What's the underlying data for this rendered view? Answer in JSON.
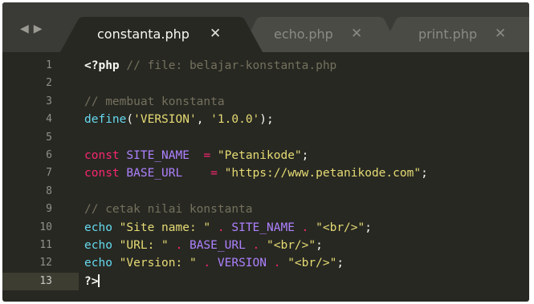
{
  "nav": {
    "back_icon": "◀",
    "forward_icon": "▶"
  },
  "tabs": [
    {
      "label": "constanta.php",
      "close": "✕",
      "active": true
    },
    {
      "label": "echo.php",
      "close": "✕",
      "active": false
    },
    {
      "label": "print.php",
      "close": "✕",
      "active": false
    }
  ],
  "colors": {
    "background": "#272822",
    "comment": "#75715e",
    "string": "#e6db74",
    "keyword": "#f92672",
    "function": "#66d9ef",
    "constant": "#ae81ff"
  },
  "editor": {
    "current_line": 13,
    "line_numbers": [
      "1",
      "2",
      "3",
      "4",
      "5",
      "6",
      "7",
      "8",
      "9",
      "10",
      "11",
      "12",
      "13"
    ],
    "lines": [
      [
        {
          "t": "tag",
          "v": "<?php"
        },
        {
          "t": "cm",
          "v": " // file: belajar-konstanta.php"
        }
      ],
      [],
      [
        {
          "t": "cm",
          "v": "// membuat konstanta"
        }
      ],
      [
        {
          "t": "fn",
          "v": "define"
        },
        {
          "t": "plain",
          "v": "("
        },
        {
          "t": "str",
          "v": "'VERSION'"
        },
        {
          "t": "plain",
          "v": ", "
        },
        {
          "t": "str",
          "v": "'1.0.0'"
        },
        {
          "t": "plain",
          "v": ");"
        }
      ],
      [],
      [
        {
          "t": "kw",
          "v": "const"
        },
        {
          "t": "plain",
          "v": " "
        },
        {
          "t": "const",
          "v": "SITE_NAME"
        },
        {
          "t": "plain",
          "v": "  "
        },
        {
          "t": "op",
          "v": "="
        },
        {
          "t": "plain",
          "v": " "
        },
        {
          "t": "str",
          "v": "\"Petanikode\""
        },
        {
          "t": "plain",
          "v": ";"
        }
      ],
      [
        {
          "t": "kw",
          "v": "const"
        },
        {
          "t": "plain",
          "v": " "
        },
        {
          "t": "const",
          "v": "BASE_URL"
        },
        {
          "t": "plain",
          "v": "    "
        },
        {
          "t": "op",
          "v": "="
        },
        {
          "t": "plain",
          "v": " "
        },
        {
          "t": "str",
          "v": "\"https://www.petanikode.com\""
        },
        {
          "t": "plain",
          "v": ";"
        }
      ],
      [],
      [
        {
          "t": "cm",
          "v": "// cetak nilai konstanta"
        }
      ],
      [
        {
          "t": "fn",
          "v": "echo"
        },
        {
          "t": "plain",
          "v": " "
        },
        {
          "t": "str",
          "v": "\"Site name: \""
        },
        {
          "t": "plain",
          "v": " "
        },
        {
          "t": "op",
          "v": "."
        },
        {
          "t": "plain",
          "v": " "
        },
        {
          "t": "const",
          "v": "SITE_NAME"
        },
        {
          "t": "plain",
          "v": " "
        },
        {
          "t": "op",
          "v": "."
        },
        {
          "t": "plain",
          "v": " "
        },
        {
          "t": "str",
          "v": "\"<br/>\""
        },
        {
          "t": "plain",
          "v": ";"
        }
      ],
      [
        {
          "t": "fn",
          "v": "echo"
        },
        {
          "t": "plain",
          "v": " "
        },
        {
          "t": "str",
          "v": "\"URL: \""
        },
        {
          "t": "plain",
          "v": " "
        },
        {
          "t": "op",
          "v": "."
        },
        {
          "t": "plain",
          "v": " "
        },
        {
          "t": "const",
          "v": "BASE_URL"
        },
        {
          "t": "plain",
          "v": " "
        },
        {
          "t": "op",
          "v": "."
        },
        {
          "t": "plain",
          "v": " "
        },
        {
          "t": "str",
          "v": "\"<br/>\""
        },
        {
          "t": "plain",
          "v": ";"
        }
      ],
      [
        {
          "t": "fn",
          "v": "echo"
        },
        {
          "t": "plain",
          "v": " "
        },
        {
          "t": "str",
          "v": "\"Version: \""
        },
        {
          "t": "plain",
          "v": " "
        },
        {
          "t": "op",
          "v": "."
        },
        {
          "t": "plain",
          "v": " "
        },
        {
          "t": "const",
          "v": "VERSION"
        },
        {
          "t": "plain",
          "v": " "
        },
        {
          "t": "op",
          "v": "."
        },
        {
          "t": "plain",
          "v": " "
        },
        {
          "t": "str",
          "v": "\"<br/>\""
        },
        {
          "t": "plain",
          "v": ";"
        }
      ],
      [
        {
          "t": "tag",
          "v": "?>"
        }
      ]
    ]
  }
}
